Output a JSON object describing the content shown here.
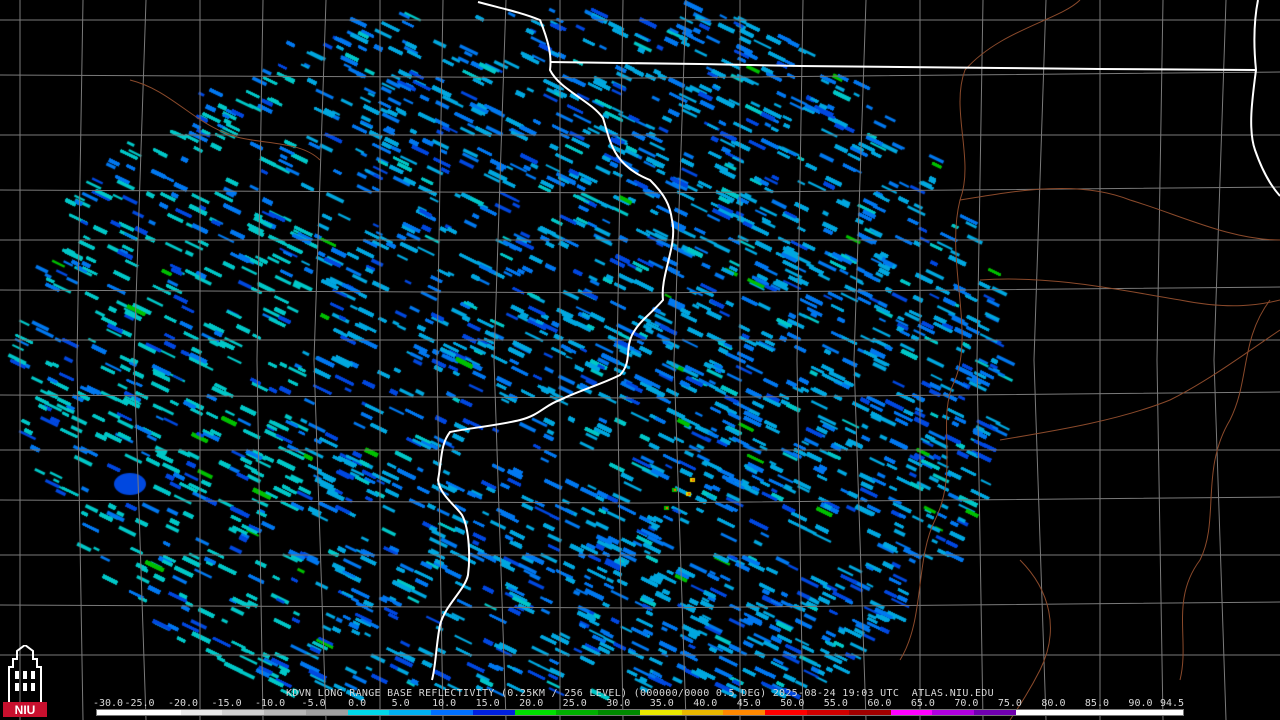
{
  "caption": "KDVN LONG RANGE BASE REFLECTIVITY (0.25KM / 256 LEVEL) (000000/0000 0.5 DEG) 2025-08-24 19:03 UTC  ATLAS.NIU.EDU",
  "logo": {
    "text": "NIU",
    "color": "#c8102e"
  },
  "scale": {
    "labels": [
      "-30.0",
      "-25.0",
      "-20.0",
      "-15.0",
      "-10.0",
      "-5.0",
      "0.0",
      "5.0",
      "10.0",
      "15.0",
      "20.0",
      "25.0",
      "30.0",
      "35.0",
      "40.0",
      "45.0",
      "50.0",
      "55.0",
      "60.0",
      "65.0",
      "70.0",
      "75.0",
      "80.0",
      "85.0",
      "90.0",
      "94.5"
    ],
    "colors": [
      "#ffffff",
      "#ffffff",
      "#e8e8e8",
      "#d0d0d0",
      "#b8b8b8",
      "#a0a0a0",
      "#00d8e8",
      "#00b0f0",
      "#0070ff",
      "#0020e0",
      "#00e000",
      "#00b000",
      "#008800",
      "#e8e800",
      "#e8b800",
      "#ff8800",
      "#ff0000",
      "#d00000",
      "#a00000",
      "#ff00ff",
      "#b000e0",
      "#7000b0",
      "#ffffff",
      "#ffffff",
      "#ffffff",
      "#ffffff"
    ]
  },
  "map": {
    "radar_colors": [
      "#00c8c8",
      "#00a8e0",
      "#0078f0",
      "#0048e0",
      "#00c000",
      "#e8d800",
      "#ff6000"
    ],
    "state_line_color": "#ffffff",
    "county_line_color": "#7a7a7a",
    "river_color": "#8b4a2b"
  }
}
